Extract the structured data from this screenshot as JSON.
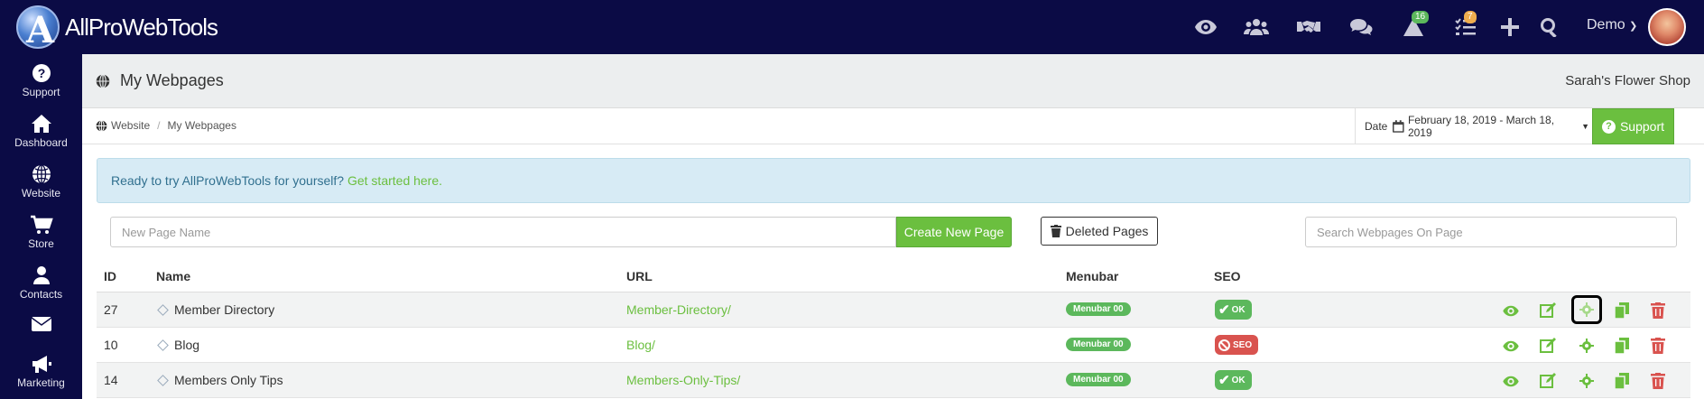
{
  "app": {
    "logo_text": "AllProWebTools"
  },
  "topbar": {
    "notifications_count": "16",
    "tasks_count": "7",
    "user_name": "Demo"
  },
  "sidebar": {
    "items": [
      {
        "label": "Support",
        "icon": "question-circle-icon"
      },
      {
        "label": "Dashboard",
        "icon": "home-icon"
      },
      {
        "label": "Website",
        "icon": "globe-icon"
      },
      {
        "label": "Store",
        "icon": "cart-icon"
      },
      {
        "label": "Contacts",
        "icon": "person-icon"
      },
      {
        "label": "",
        "icon": "envelope-icon"
      },
      {
        "label": "Marketing",
        "icon": "megaphone-icon"
      }
    ]
  },
  "header": {
    "title": "My Webpages",
    "shop_name": "Sarah's Flower Shop"
  },
  "breadcrumb": {
    "root": "Website",
    "current": "My Webpages"
  },
  "date_filter": {
    "label": "Date",
    "range": "February 18, 2019 - March 18, 2019"
  },
  "support_button": "Support",
  "alert": {
    "text": "Ready to try AllProWebTools for yourself?",
    "link": "Get started here."
  },
  "controls": {
    "new_page_placeholder": "New Page Name",
    "create_button": "Create New Page",
    "deleted_button": "Deleted Pages",
    "search_placeholder": "Search Webpages On Page"
  },
  "table": {
    "headers": {
      "id": "ID",
      "name": "Name",
      "url": "URL",
      "menubar": "Menubar",
      "seo": "SEO"
    },
    "rows": [
      {
        "id": "27",
        "name": "Member Directory",
        "url": "Member-Directory/",
        "menubar": "Menubar 00",
        "seo": "OK",
        "seo_status": "ok"
      },
      {
        "id": "10",
        "name": "Blog",
        "url": "Blog/",
        "menubar": "Menubar 00",
        "seo": "SEO",
        "seo_status": "bad"
      },
      {
        "id": "14",
        "name": "Members Only Tips",
        "url": "Members-Only-Tips/",
        "menubar": "Menubar 00",
        "seo": "OK",
        "seo_status": "ok"
      }
    ]
  },
  "colors": {
    "nav_bg": "#0b0b45",
    "accent_green": "#6bbf3f",
    "danger_red": "#d9534f"
  }
}
